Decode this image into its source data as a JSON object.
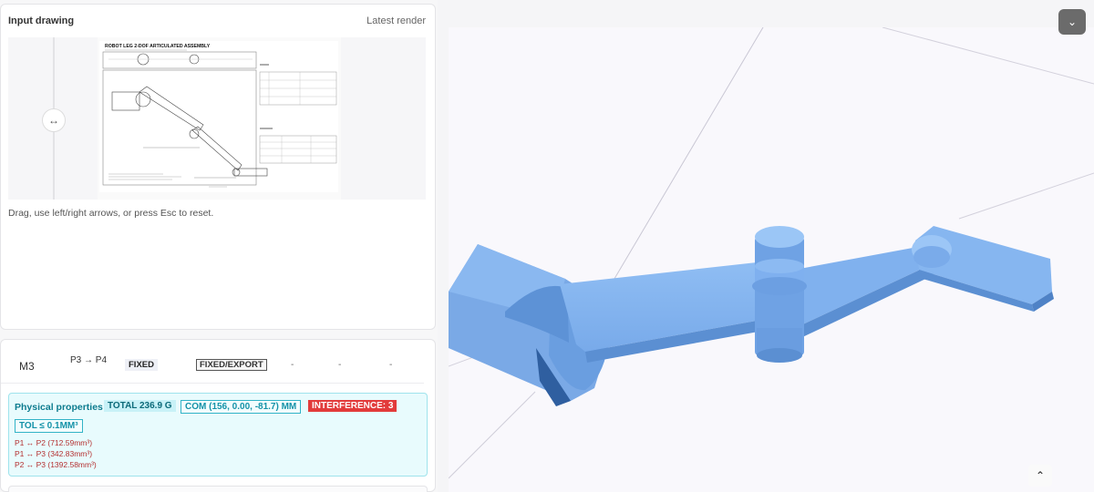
{
  "input_panel": {
    "title": "Input drawing",
    "latest_label": "Latest render",
    "compare_handle_icon": "left-right-arrow-icon",
    "hint": "Drag, use left/right arrows, or press Esc to reset.",
    "drawing_title": "ROBOT LEG 2-DOF ARTICULATED ASSEMBLY"
  },
  "table": {
    "row": {
      "id": "M3",
      "path": "P3 → P4",
      "type": "FIXED",
      "status": "FIXED/EXPORT",
      "col1": "-",
      "col2": "-",
      "col3": "-"
    }
  },
  "physical": {
    "title": "Physical properties",
    "total": "TOTAL 236.9 G",
    "com": "COM (156, 0.00, -81.7) MM",
    "interference": "INTERFERENCE: 3",
    "tolerance": "TOL ≤ 0.1MM³",
    "pairs": [
      "P1 ↔ P2 (712.59mm³)",
      "P1 ↔ P3 (342.83mm³)",
      "P2 ↔ P3 (1392.58mm³)"
    ]
  },
  "viewer": {
    "collapse_icon": "chevron-down-icon",
    "scroll_up_icon": "chevron-up-icon",
    "model_color": "#7fb0ef"
  }
}
